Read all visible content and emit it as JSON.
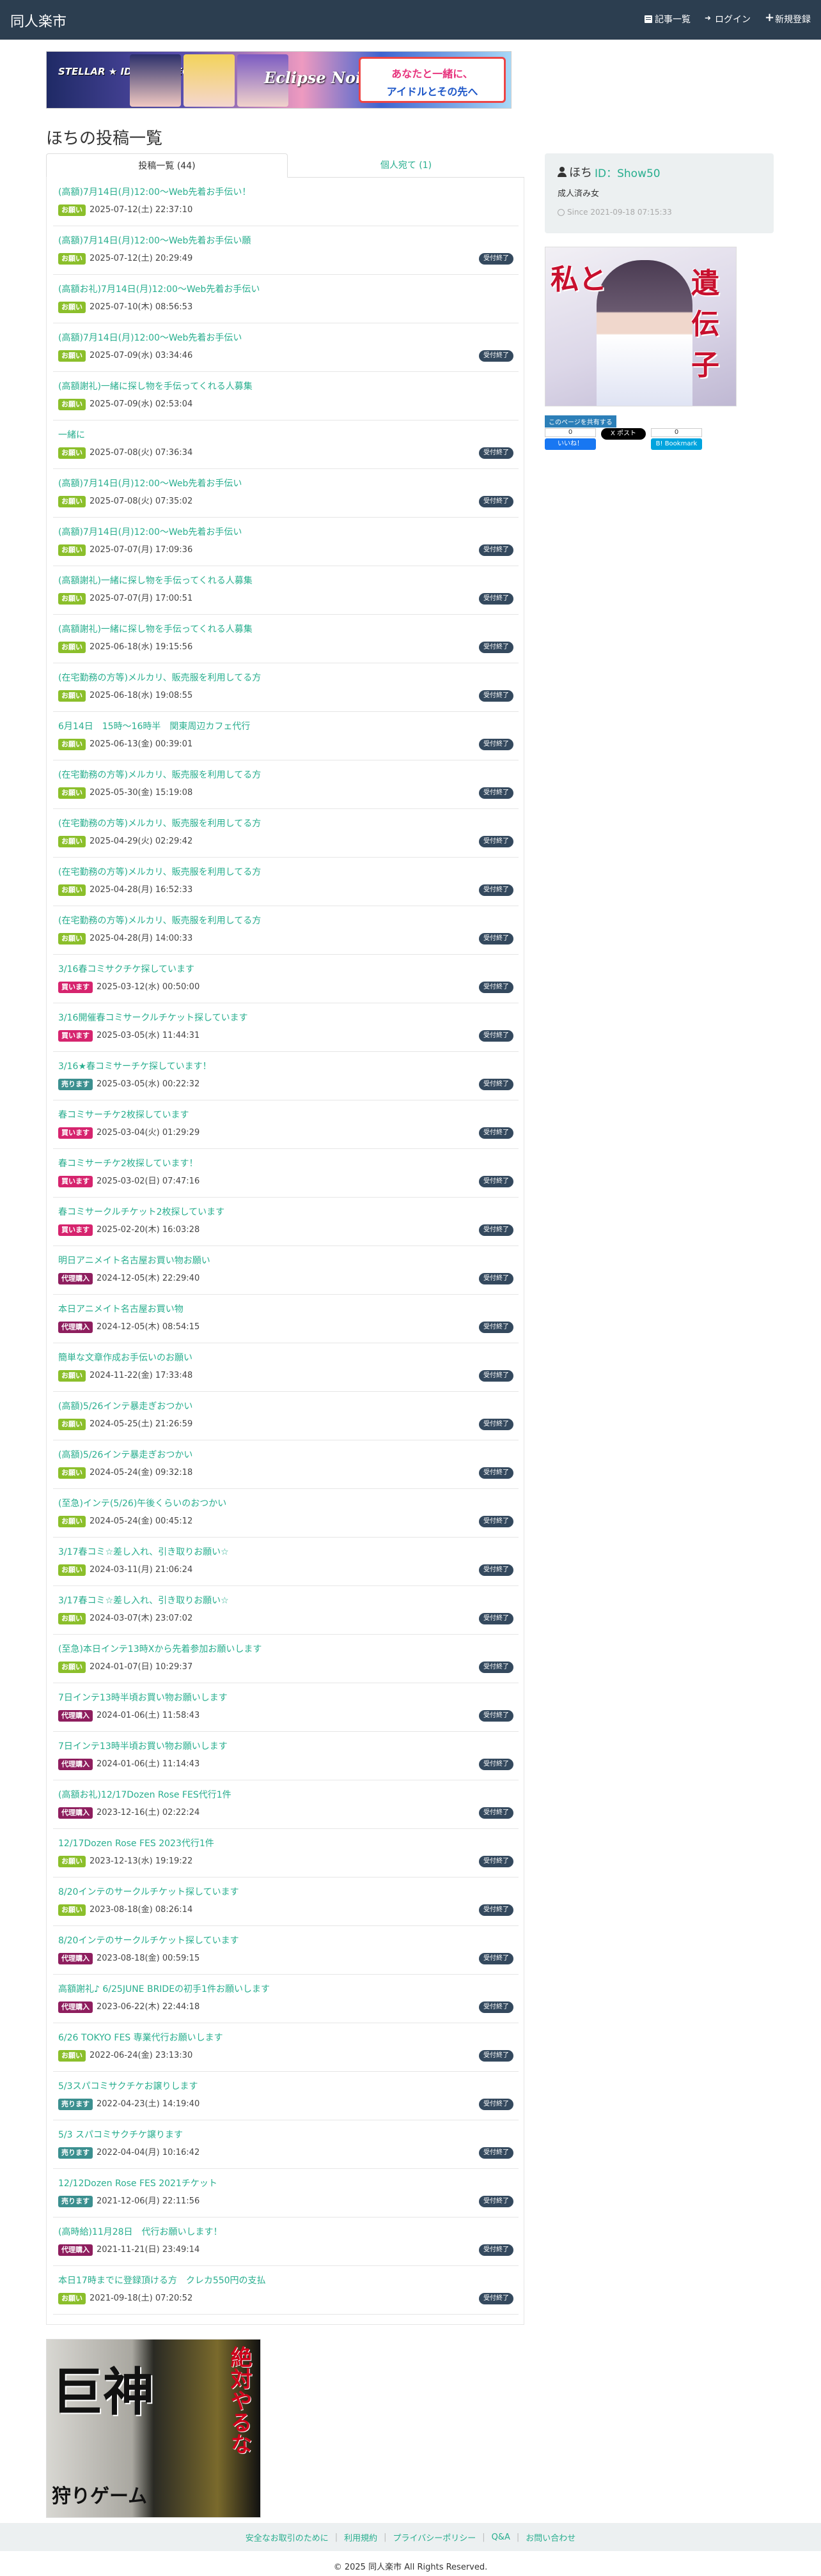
{
  "nav": {
    "brand": "同人楽市",
    "links": [
      {
        "label": "記事一覧",
        "icon": "document-icon"
      },
      {
        "label": "ログイン",
        "icon": "login-icon"
      },
      {
        "label": "新規登録",
        "icon": "plus-icon"
      }
    ]
  },
  "banner": {
    "logo": "STELLAR ★ IDOL PROJECT",
    "title": "Eclipse Noire",
    "line1": "あなたと一緒に、",
    "line2": "アイドルとその先へ"
  },
  "page_title": "ほちの投稿一覧",
  "tabs": [
    {
      "label": "投稿一覧 (44)"
    },
    {
      "label": "個人宛て (1)"
    }
  ],
  "colors": {
    "navbar": "#2c3e50",
    "link": "#27ae8e",
    "badge_onegai": "#8bbf2b",
    "badge_kaimasu": "#d6246e",
    "badge_urimasu": "#3b8f8f",
    "badge_dairi": "#8e1e5e",
    "closed": "#34495e"
  },
  "posts": [
    {
      "title": "(高額)7月14日(月)12:00〜Web先着お手伝い！",
      "badge": "お願い",
      "date": "2025-07-12(土) 22:37:10",
      "closed": ""
    },
    {
      "title": "(高額)7月14日(月)12:00〜Web先着お手伝い願",
      "badge": "お願い",
      "date": "2025-07-12(土) 20:29:49",
      "closed": "受付終了"
    },
    {
      "title": "(高額お礼)7月14日(月)12:00〜Web先着お手伝い",
      "badge": "お願い",
      "date": "2025-07-10(木) 08:56:53",
      "closed": ""
    },
    {
      "title": "(高額)7月14日(月)12:00〜Web先着お手伝い",
      "badge": "お願い",
      "date": "2025-07-09(水) 03:34:46",
      "closed": "受付終了"
    },
    {
      "title": "(高額謝礼)一緒に探し物を手伝ってくれる人募集",
      "badge": "お願い",
      "date": "2025-07-09(水) 02:53:04",
      "closed": ""
    },
    {
      "title": "一緒に",
      "badge": "お願い",
      "date": "2025-07-08(火) 07:36:34",
      "closed": "受付終了"
    },
    {
      "title": "(高額)7月14日(月)12:00〜Web先着お手伝い",
      "badge": "お願い",
      "date": "2025-07-08(火) 07:35:02",
      "closed": "受付終了"
    },
    {
      "title": "(高額)7月14日(月)12:00〜Web先着お手伝い",
      "badge": "お願い",
      "date": "2025-07-07(月) 17:09:36",
      "closed": "受付終了"
    },
    {
      "title": "(高額謝礼)一緒に探し物を手伝ってくれる人募集",
      "badge": "お願い",
      "date": "2025-07-07(月) 17:00:51",
      "closed": "受付終了"
    },
    {
      "title": "(高額謝礼)一緒に探し物を手伝ってくれる人募集",
      "badge": "お願い",
      "date": "2025-06-18(水) 19:15:56",
      "closed": "受付終了"
    },
    {
      "title": "(在宅勤務の方等)メルカリ、販売服を利用してる方",
      "badge": "お願い",
      "date": "2025-06-18(水) 19:08:55",
      "closed": "受付終了"
    },
    {
      "title": "6月14日　15時〜16時半　関東周辺カフェ代行",
      "badge": "お願い",
      "date": "2025-06-13(金) 00:39:01",
      "closed": "受付終了"
    },
    {
      "title": "(在宅勤務の方等)メルカリ、販売服を利用してる方",
      "badge": "お願い",
      "date": "2025-05-30(金) 15:19:08",
      "closed": "受付終了"
    },
    {
      "title": "(在宅勤務の方等)メルカリ、販売服を利用してる方",
      "badge": "お願い",
      "date": "2025-04-29(火) 02:29:42",
      "closed": "受付終了"
    },
    {
      "title": "(在宅勤務の方等)メルカリ、販売服を利用してる方",
      "badge": "お願い",
      "date": "2025-04-28(月) 16:52:33",
      "closed": "受付終了"
    },
    {
      "title": "(在宅勤務の方等)メルカリ、販売服を利用してる方",
      "badge": "お願い",
      "date": "2025-04-28(月) 14:00:33",
      "closed": "受付終了"
    },
    {
      "title": "3/16春コミサクチケ探しています",
      "badge": "買います",
      "date": "2025-03-12(水) 00:50:00",
      "closed": "受付終了"
    },
    {
      "title": "3/16開催春コミサークルチケット探しています",
      "badge": "買います",
      "date": "2025-03-05(水) 11:44:31",
      "closed": "受付終了"
    },
    {
      "title": "3/16★春コミサーチケ探しています！",
      "badge": "売ります",
      "date": "2025-03-05(水) 00:22:32",
      "closed": "受付終了"
    },
    {
      "title": "春コミサーチケ2枚探しています",
      "badge": "買います",
      "date": "2025-03-04(火) 01:29:29",
      "closed": "受付終了"
    },
    {
      "title": "春コミサーチケ2枚探しています！",
      "badge": "買います",
      "date": "2025-03-02(日) 07:47:16",
      "closed": "受付終了"
    },
    {
      "title": "春コミサークルチケット2枚探しています",
      "badge": "買います",
      "date": "2025-02-20(木) 16:03:28",
      "closed": "受付終了"
    },
    {
      "title": "明日アニメイト名古屋お買い物お願い",
      "badge": "代理購入",
      "date": "2024-12-05(木) 22:29:40",
      "closed": "受付終了"
    },
    {
      "title": "本日アニメイト名古屋お買い物",
      "badge": "代理購入",
      "date": "2024-12-05(木) 08:54:15",
      "closed": "受付終了"
    },
    {
      "title": "簡単な文章作成お手伝いのお願い",
      "badge": "お願い",
      "date": "2024-11-22(金) 17:33:48",
      "closed": "受付終了"
    },
    {
      "title": "(高額)5/26インテ暴走ぎおつかい",
      "badge": "お願い",
      "date": "2024-05-25(土) 21:26:59",
      "closed": "受付終了"
    },
    {
      "title": "(高額)5/26インテ暴走ぎおつかい",
      "badge": "お願い",
      "date": "2024-05-24(金) 09:32:18",
      "closed": "受付終了"
    },
    {
      "title": "(至急)インテ(5/26)午後くらいのおつかい",
      "badge": "お願い",
      "date": "2024-05-24(金) 00:45:12",
      "closed": "受付終了"
    },
    {
      "title": "3/17春コミ☆差し入れ、引き取りお願い☆",
      "badge": "お願い",
      "date": "2024-03-11(月) 21:06:24",
      "closed": "受付終了"
    },
    {
      "title": "3/17春コミ☆差し入れ、引き取りお願い☆",
      "badge": "お願い",
      "date": "2024-03-07(木) 23:07:02",
      "closed": "受付終了"
    },
    {
      "title": "(至急)本日インテ13時Xから先着参加お願いします",
      "badge": "お願い",
      "date": "2024-01-07(日) 10:29:37",
      "closed": "受付終了"
    },
    {
      "title": "7日インテ13時半頃お買い物お願いします",
      "badge": "代理購入",
      "date": "2024-01-06(土) 11:58:43",
      "closed": "受付終了"
    },
    {
      "title": "7日インテ13時半頃お買い物お願いします",
      "badge": "代理購入",
      "date": "2024-01-06(土) 11:14:43",
      "closed": "受付終了"
    },
    {
      "title": "(高額お礼)12/17Dozen Rose FES代行1件",
      "badge": "代理購入",
      "date": "2023-12-16(土) 02:22:24",
      "closed": "受付終了"
    },
    {
      "title": "12/17Dozen Rose FES 2023代行1件",
      "badge": "お願い",
      "date": "2023-12-13(水) 19:19:22",
      "closed": "受付終了"
    },
    {
      "title": "8/20インテのサークルチケット探しています",
      "badge": "お願い",
      "date": "2023-08-18(金) 08:26:14",
      "closed": "受付終了"
    },
    {
      "title": "8/20インテのサークルチケット探しています",
      "badge": "代理購入",
      "date": "2023-08-18(金) 00:59:15",
      "closed": "受付終了"
    },
    {
      "title": "高額謝礼♪ 6/25JUNE BRIDEの初手1件お願いします",
      "badge": "代理購入",
      "date": "2023-06-22(木) 22:44:18",
      "closed": "受付終了"
    },
    {
      "title": "6/26 TOKYO FES 専業代行お願いします",
      "badge": "お願い",
      "date": "2022-06-24(金) 23:13:30",
      "closed": "受付終了"
    },
    {
      "title": "5/3スパコミサクチケお譲りします",
      "badge": "売ります",
      "date": "2022-04-23(土) 14:19:40",
      "closed": "受付終了"
    },
    {
      "title": "5/3 スパコミサクチケ譲ります",
      "badge": "売ります",
      "date": "2022-04-04(月) 10:16:42",
      "closed": "受付終了"
    },
    {
      "title": "12/12Dozen Rose FES 2021チケット",
      "badge": "売ります",
      "date": "2021-12-06(月) 22:11:56",
      "closed": "受付終了"
    },
    {
      "title": "(高時給)11月28日　代行お願いします！",
      "badge": "代理購入",
      "date": "2021-11-21(日) 23:49:14",
      "closed": "受付終了"
    },
    {
      "title": "本日17時までに登録頂ける方　クレカ550円の支払",
      "badge": "お願い",
      "date": "2021-09-18(土) 07:20:52",
      "closed": "受付終了"
    }
  ],
  "profile": {
    "name": "ほち",
    "id": "ID：Show50",
    "desc": "成人済み女",
    "since": "Since 2021-09-18 07:15:33"
  },
  "side_ad": {
    "text1": "私と",
    "text2": "遺伝子"
  },
  "share": {
    "label": "このページを共有する",
    "fb_count": "0",
    "fb_label": "いいね！",
    "tw_label": "X ポスト",
    "hb_count": "0",
    "hb_label": "B! Bookmark"
  },
  "bottom_ad": {
    "big": "巨神",
    "sub": "狩りゲーム",
    "red": "絶対やるな"
  },
  "footer": {
    "links": [
      "安全なお取引のために",
      "利用規約",
      "プライバシーポリシー",
      "Q&A",
      "お問い合わせ"
    ],
    "copyright": "© 2025 同人楽市 All Rights Reserved."
  }
}
